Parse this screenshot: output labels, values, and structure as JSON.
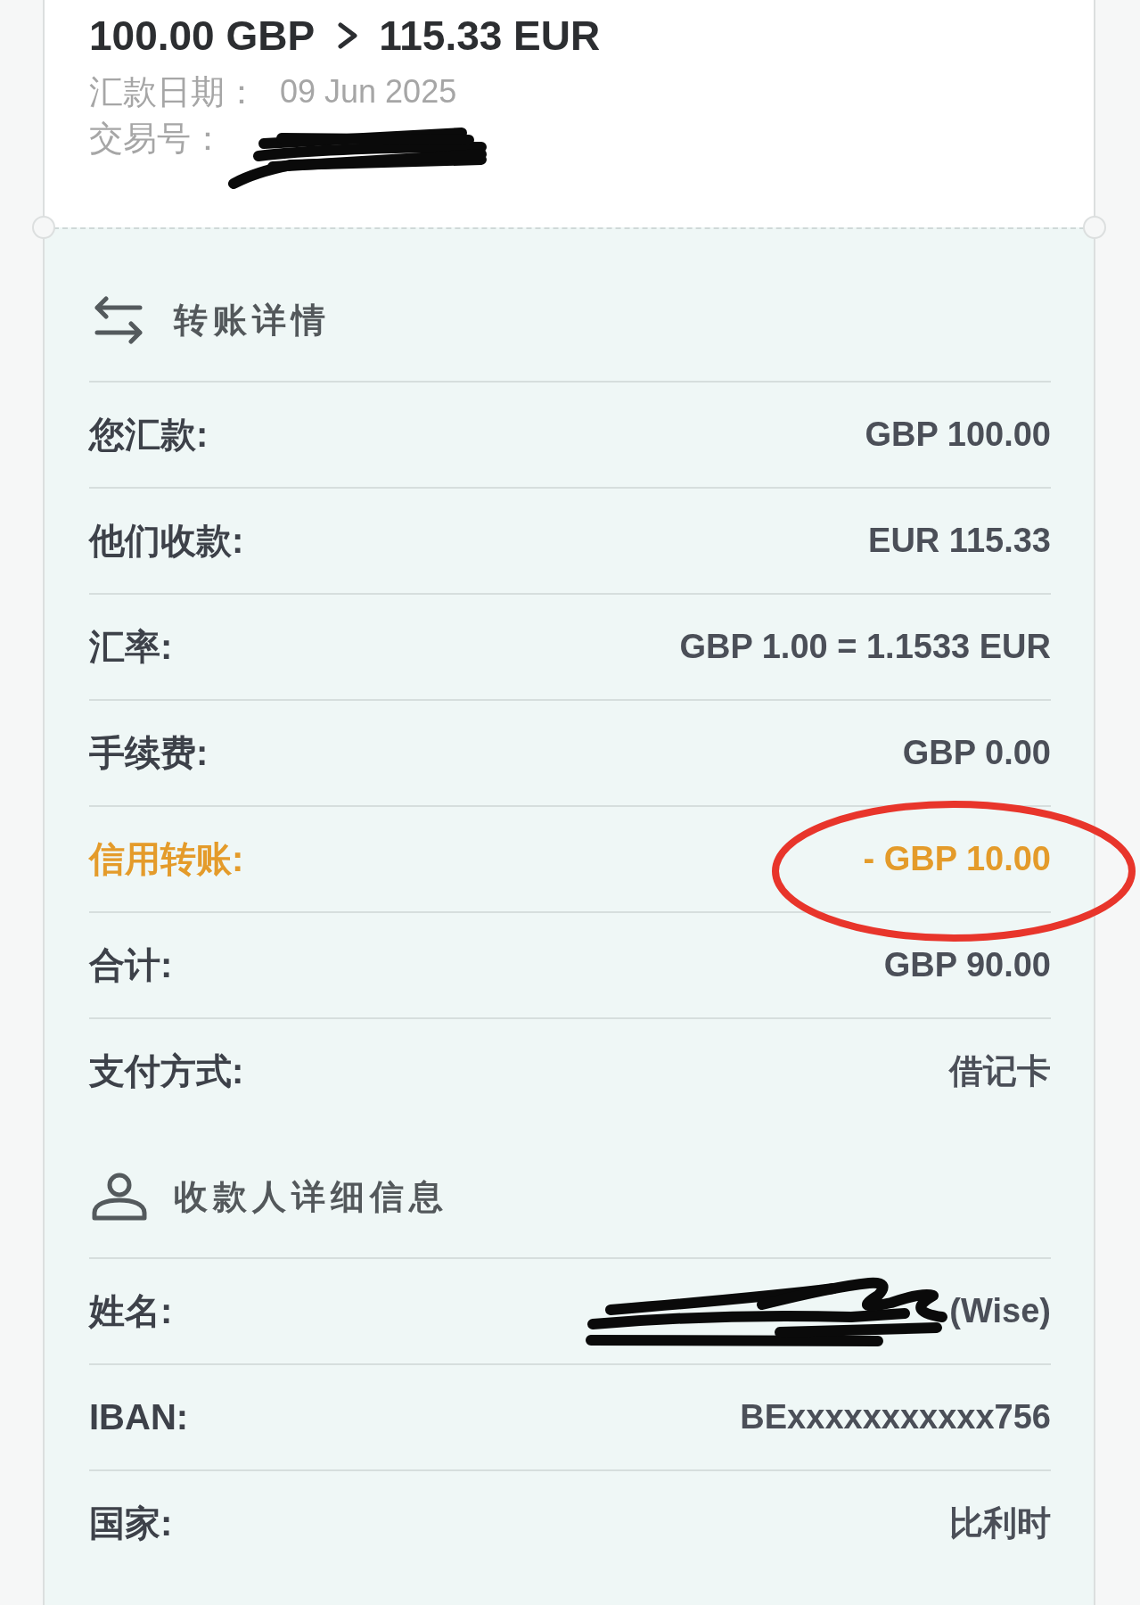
{
  "transfer": {
    "from_amount": "100.00 GBP",
    "to_amount": "115.33 EUR",
    "meta": [
      {
        "label": "汇款日期：",
        "value": "09 Jun 2025"
      },
      {
        "label": "交易号：",
        "redacted": true
      }
    ]
  },
  "sections": [
    {
      "kind": "transfer",
      "title": "转账详情",
      "rows": [
        {
          "label": "您汇款:",
          "value": "GBP 100.00",
          "highlighted": false
        },
        {
          "label": "他们收款:",
          "value": "EUR 115.33",
          "highlighted": false
        },
        {
          "label": "汇率:",
          "value": "GBP 1.00 = 1.1533 EUR",
          "highlighted": false
        },
        {
          "label": "手续费:",
          "value": "GBP 0.00",
          "highlighted": false
        },
        {
          "label": "信用转账:",
          "value": "- GBP 10.00",
          "highlighted": true,
          "circled": true
        },
        {
          "label": "合计:",
          "value": "GBP 90.00",
          "highlighted": false
        },
        {
          "label": "支付方式:",
          "value": "借记卡",
          "highlighted": false
        }
      ]
    },
    {
      "kind": "recipient",
      "title": "收款人详细信息",
      "rows": [
        {
          "label": "姓名:",
          "value": "(Wise)",
          "highlighted": false,
          "redacted": true
        },
        {
          "label": "IBAN:",
          "value": "BExxxxxxxxxxx756",
          "highlighted": false
        },
        {
          "label": "国家:",
          "value": "比利时",
          "highlighted": false
        }
      ]
    }
  ]
}
